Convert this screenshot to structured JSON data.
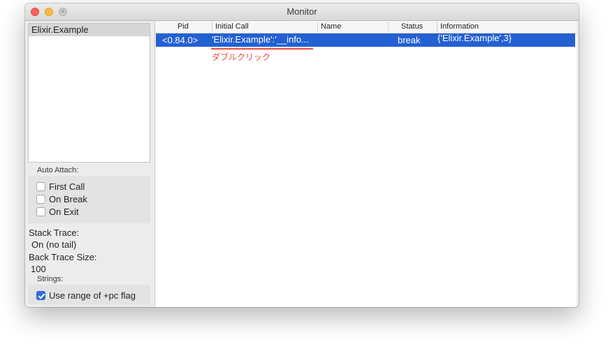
{
  "window": {
    "title": "Monitor"
  },
  "sidebar": {
    "modules": [
      "Elixir.Example"
    ],
    "auto_attach_label": "Auto Attach:",
    "auto_attach": [
      {
        "label": "First Call",
        "checked": false
      },
      {
        "label": "On Break",
        "checked": false
      },
      {
        "label": "On Exit",
        "checked": false
      }
    ],
    "stack_trace_label": "Stack Trace:",
    "stack_trace_value": "On (no tail)",
    "back_trace_label": "Back Trace Size:",
    "back_trace_value": "100",
    "strings_label": "Strings:",
    "strings_option": {
      "label": "Use range of +pc flag",
      "checked": true
    }
  },
  "table": {
    "columns": [
      "Pid",
      "Initial Call",
      "Name",
      "Status",
      "Information"
    ],
    "rows": [
      {
        "pid": "<0.84.0>",
        "initial_call": "'Elixir.Example':'__info...",
        "name": "",
        "status": "break",
        "information": "{'Elixir.Example',3}"
      }
    ]
  },
  "annotation": {
    "text": "ダブルクリック",
    "color": "#e74c3c"
  },
  "colors": {
    "selection": "#2360d2",
    "accent_checkbox": "#2e6fdf"
  }
}
